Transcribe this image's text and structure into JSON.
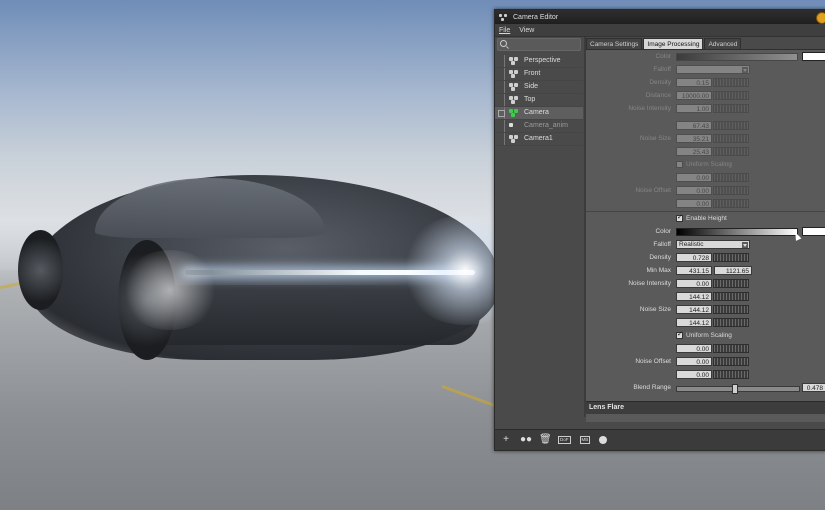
{
  "window": {
    "title": "Camera Editor"
  },
  "menu": {
    "items": [
      "File",
      "View"
    ]
  },
  "tree": {
    "items": [
      {
        "label": "Perspective",
        "icon": "camera-icon",
        "selected": false
      },
      {
        "label": "Front",
        "icon": "camera-icon",
        "selected": false
      },
      {
        "label": "Side",
        "icon": "camera-icon",
        "selected": false
      },
      {
        "label": "Top",
        "icon": "camera-icon",
        "selected": false
      },
      {
        "label": "Camera",
        "icon": "camera-icon",
        "selected": true
      },
      {
        "label": "Camera_anim",
        "icon": "lock-icon",
        "selected": false
      },
      {
        "label": "Camera1",
        "icon": "camera-icon",
        "selected": false
      }
    ]
  },
  "tabs": [
    "Camera Settings",
    "Image Processing",
    "Advanced"
  ],
  "active_tab": "Image Processing",
  "fog_top": {
    "color_label": "Color",
    "falloff_label": "Falloff",
    "density_label": "Density",
    "density_value": "0.15",
    "distance_label": "Distance",
    "distance_value": "10000.00",
    "noise_intensity_label": "Noise Intensity",
    "noise_intensity_value": "1.00",
    "noise_size_label": "Noise Size",
    "noise_size_values": [
      "67.43",
      "35.21",
      "25.43"
    ],
    "uniform_scaling_label": "Uniform Scaling",
    "uniform_scaling_checked": false,
    "noise_offset_label": "Noise Offset",
    "noise_offset_values": [
      "0.00",
      "0.00",
      "0.00"
    ]
  },
  "height_fog": {
    "enable_label": "Enable Height",
    "enable_checked": true,
    "color_label": "Color",
    "falloff_label": "Falloff",
    "falloff_value": "Realistic",
    "density_label": "Density",
    "density_value": "0.728",
    "minmax_label": "Min Max",
    "min_value": "431.15",
    "max_value": "1121.65",
    "noise_intensity_label": "Noise Intensity",
    "noise_intensity_value": "0.00",
    "noise_size_label": "Noise Size",
    "noise_size_values": [
      "144.12",
      "144.12",
      "144.12"
    ],
    "uniform_scaling_label": "Uniform Scaling",
    "uniform_scaling_checked": true,
    "noise_offset_label": "Noise Offset",
    "noise_offset_values": [
      "0.00",
      "0.00",
      "0.00"
    ],
    "blend_range_label": "Blend Range",
    "blend_range_value": "0.478",
    "blend_range_fraction": 0.478
  },
  "lens_flare": {
    "label": "Lens Flare"
  },
  "toolbar": {
    "icons": [
      "plus-icon",
      "duplicate-icon",
      "trash-icon",
      "dof-icon",
      "mb-icon",
      "circle-icon"
    ],
    "dof_badge": "DoF",
    "mb_badge": "MB"
  }
}
